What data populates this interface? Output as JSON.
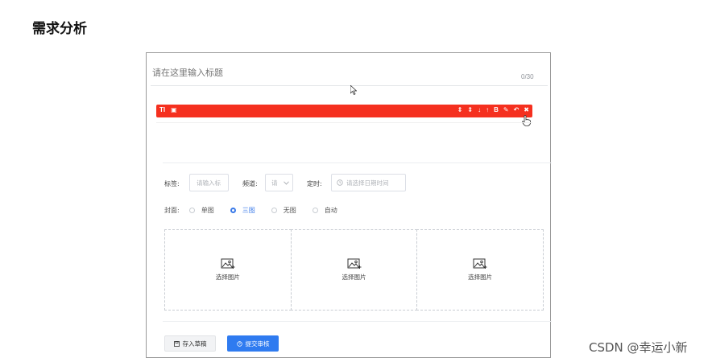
{
  "heading": "需求分析",
  "editor": {
    "title_placeholder": "请在这里输入标题",
    "counter": "0/30",
    "toolbar_left": [
      "TI",
      "▣"
    ],
    "toolbar_right": [
      "⇕",
      "⇕",
      "↓",
      "↑",
      "B",
      "✎",
      "↶",
      "✖"
    ]
  },
  "form": {
    "tag_label": "标签:",
    "tag_placeholder": "请输入标",
    "channel_label": "频道:",
    "channel_value": "请",
    "schedule_label": "定时:",
    "schedule_placeholder": "请选择日期时间",
    "cover_label": "封面:",
    "cover_options": [
      "单图",
      "三图",
      "无图",
      "自动"
    ],
    "cover_selected": "三图",
    "upload_slots": [
      "选择图片",
      "选择图片",
      "选择图片"
    ]
  },
  "actions": {
    "draft_label": "存入草稿",
    "submit_label": "提交审核"
  },
  "watermark": "CSDN @幸运小新",
  "colors": {
    "toolbar_red": "#f5301f",
    "primary_blue": "#2f7bf0"
  }
}
